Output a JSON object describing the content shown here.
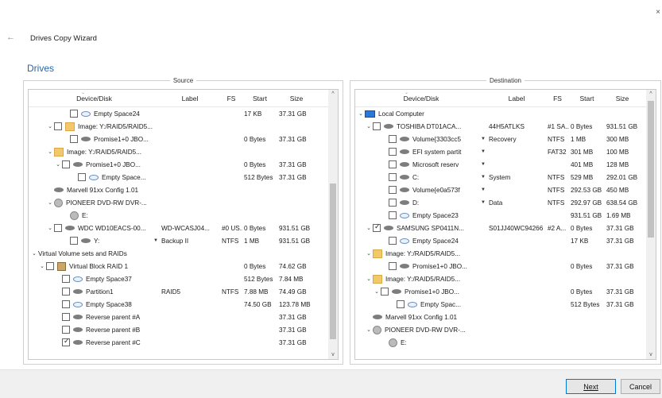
{
  "window": {
    "close_glyph": "×",
    "back_glyph": "←",
    "title": "Drives Copy Wizard"
  },
  "section_title": "Drives",
  "source": {
    "title": "Source",
    "columns": [
      "Device/Disk",
      "Label",
      "FS",
      "Start",
      "Size"
    ],
    "rows": [
      {
        "indent": 4,
        "exp": "",
        "chk": "off",
        "icon": "empty",
        "name": "Empty Space24",
        "label": "",
        "fs": "",
        "start": "17 KB",
        "size": "37.31 GB"
      },
      {
        "indent": 2,
        "exp": "v",
        "chk": "off",
        "icon": "folder",
        "name": "Image: Y:/RAID5/RAID5...",
        "label": "",
        "fs": "",
        "start": "",
        "size": ""
      },
      {
        "indent": 4,
        "exp": "",
        "chk": "off",
        "icon": "hdd",
        "name": "Promise1+0 JBO...",
        "label": "",
        "fs": "",
        "start": "0 Bytes",
        "size": "37.31 GB"
      },
      {
        "indent": 2,
        "exp": "v",
        "chk": "none",
        "icon": "folder",
        "name": "Image: Y:/RAID5/RAID5...",
        "label": "",
        "fs": "",
        "start": "",
        "size": ""
      },
      {
        "indent": 3,
        "exp": "v",
        "chk": "off",
        "icon": "hdd",
        "name": "Promise1+0 JBO...",
        "label": "",
        "fs": "",
        "start": "0 Bytes",
        "size": "37.31 GB"
      },
      {
        "indent": 5,
        "exp": "",
        "chk": "off",
        "icon": "empty",
        "name": "Empty Space...",
        "label": "",
        "fs": "",
        "start": "512 Bytes",
        "size": "37.31 GB"
      },
      {
        "indent": 2,
        "exp": "",
        "chk": "none",
        "icon": "hdd",
        "name": "Marvell 91xx Config 1.01",
        "label": "",
        "fs": "",
        "start": "",
        "size": ""
      },
      {
        "indent": 2,
        "exp": "v",
        "chk": "none",
        "icon": "cd",
        "name": "PIONEER DVD-RW DVR-...",
        "label": "",
        "fs": "",
        "start": "",
        "size": ""
      },
      {
        "indent": 4,
        "exp": "",
        "chk": "none",
        "icon": "cd",
        "name": "E:",
        "label": "",
        "fs": "",
        "start": "",
        "size": ""
      },
      {
        "indent": 2,
        "exp": "v",
        "chk": "off",
        "icon": "hdd",
        "name": "WDC WD10EACS-00...",
        "label": "WD-WCASJ04...",
        "fs": "#0 US...",
        "start": "0 Bytes",
        "size": "931.51 GB"
      },
      {
        "indent": 4,
        "exp": "",
        "chk": "off",
        "icon": "hdd",
        "name": "Y:",
        "dd": "▼",
        "label": "Backup II",
        "fs": "NTFS",
        "start": "1 MB",
        "size": "931.51 GB"
      },
      {
        "indent": 0,
        "exp": "v",
        "chk": "none",
        "icon": "",
        "name": "Virtual Volume sets and RAIDs",
        "label": "",
        "fs": "",
        "start": "",
        "size": ""
      },
      {
        "indent": 1,
        "exp": "v",
        "chk": "off",
        "icon": "raid",
        "name": "Virtual Block RAID 1",
        "label": "",
        "fs": "",
        "start": "0 Bytes",
        "size": "74.62 GB"
      },
      {
        "indent": 3,
        "exp": "",
        "chk": "off",
        "icon": "empty",
        "name": "Empty Space37",
        "label": "",
        "fs": "",
        "start": "512 Bytes",
        "size": "7.84 MB"
      },
      {
        "indent": 3,
        "exp": "",
        "chk": "off",
        "icon": "hdd",
        "name": "Partition1",
        "label": "RAID5",
        "fs": "NTFS",
        "start": "7.88 MB",
        "size": "74.49 GB"
      },
      {
        "indent": 3,
        "exp": "",
        "chk": "off",
        "icon": "empty",
        "name": "Empty Space38",
        "label": "",
        "fs": "",
        "start": "74.50 GB",
        "size": "123.78 MB"
      },
      {
        "indent": 3,
        "exp": "",
        "chk": "off",
        "icon": "hdd",
        "name": "Reverse parent #A",
        "label": "",
        "fs": "",
        "start": "",
        "size": "37.31 GB"
      },
      {
        "indent": 3,
        "exp": "",
        "chk": "off",
        "icon": "hdd",
        "name": "Reverse parent #B",
        "label": "",
        "fs": "",
        "start": "",
        "size": "37.31 GB"
      },
      {
        "indent": 3,
        "exp": "",
        "chk": "on",
        "icon": "hdd",
        "name": "Reverse parent #C",
        "label": "",
        "fs": "",
        "start": "",
        "size": "37.31 GB"
      }
    ]
  },
  "destination": {
    "title": "Destination",
    "columns": [
      "Device/Disk",
      "Label",
      "FS",
      "Start",
      "Size"
    ],
    "rows": [
      {
        "indent": 0,
        "exp": "v",
        "chk": "none",
        "icon": "pc",
        "name": "Local Computer",
        "label": "",
        "fs": "",
        "start": "",
        "size": ""
      },
      {
        "indent": 1,
        "exp": "v",
        "chk": "off",
        "icon": "hdd",
        "name": "TOSHIBA DT01ACA...",
        "label": "44H5ATLKS",
        "fs": "#1 SA...",
        "start": "0 Bytes",
        "size": "931.51 GB"
      },
      {
        "indent": 3,
        "exp": "",
        "chk": "off",
        "icon": "hdd",
        "name": "Volume{3303cc5",
        "dd": "▼",
        "label": "Recovery",
        "fs": "NTFS",
        "start": "1 MB",
        "size": "300 MB"
      },
      {
        "indent": 3,
        "exp": "",
        "chk": "off",
        "icon": "hdd",
        "name": "EFI system partit",
        "dd": "▼",
        "label": "",
        "fs": "FAT32",
        "start": "301 MB",
        "size": "100 MB"
      },
      {
        "indent": 3,
        "exp": "",
        "chk": "off",
        "icon": "hdd",
        "name": "Microsoft reserv",
        "dd": "▼",
        "label": "",
        "fs": "",
        "start": "401 MB",
        "size": "128 MB"
      },
      {
        "indent": 3,
        "exp": "",
        "chk": "off",
        "icon": "hdd",
        "name": "C:",
        "dd": "▼",
        "label": "System",
        "fs": "NTFS",
        "start": "529 MB",
        "size": "292.01 GB"
      },
      {
        "indent": 3,
        "exp": "",
        "chk": "off",
        "icon": "hdd",
        "name": "Volume{e0a573f",
        "dd": "▼",
        "label": "",
        "fs": "NTFS",
        "start": "292.53 GB",
        "size": "450 MB"
      },
      {
        "indent": 3,
        "exp": "",
        "chk": "off",
        "icon": "hdd",
        "name": "D:",
        "dd": "▼",
        "label": "Data",
        "fs": "NTFS",
        "start": "292.97 GB",
        "size": "638.54 GB"
      },
      {
        "indent": 3,
        "exp": "",
        "chk": "off",
        "icon": "empty",
        "name": "Empty Space23",
        "label": "",
        "fs": "",
        "start": "931.51 GB",
        "size": "1.69 MB"
      },
      {
        "indent": 1,
        "exp": "v",
        "chk": "on",
        "icon": "hdd",
        "name": "SAMSUNG SP0411N...",
        "label": "S01JJ40WC94266",
        "fs": "#2 A...",
        "start": "0 Bytes",
        "size": "37.31 GB"
      },
      {
        "indent": 3,
        "exp": "",
        "chk": "off",
        "icon": "empty",
        "name": "Empty Space24",
        "label": "",
        "fs": "",
        "start": "17 KB",
        "size": "37.31 GB"
      },
      {
        "indent": 1,
        "exp": "v",
        "chk": "none",
        "icon": "folder",
        "name": "Image: Y:/RAID5/RAID5...",
        "label": "",
        "fs": "",
        "start": "",
        "size": ""
      },
      {
        "indent": 3,
        "exp": "",
        "chk": "off",
        "icon": "hdd",
        "name": "Promise1+0 JBO...",
        "label": "",
        "fs": "",
        "start": "0 Bytes",
        "size": "37.31 GB"
      },
      {
        "indent": 1,
        "exp": "v",
        "chk": "none",
        "icon": "folder",
        "name": "Image: Y:/RAID5/RAID5...",
        "label": "",
        "fs": "",
        "start": "",
        "size": ""
      },
      {
        "indent": 2,
        "exp": "v",
        "chk": "off",
        "icon": "hdd",
        "name": "Promise1+0 JBO...",
        "label": "",
        "fs": "",
        "start": "0 Bytes",
        "size": "37.31 GB"
      },
      {
        "indent": 4,
        "exp": "",
        "chk": "off",
        "icon": "empty",
        "name": "Empty Spac...",
        "label": "",
        "fs": "",
        "start": "512 Bytes",
        "size": "37.31 GB"
      },
      {
        "indent": 1,
        "exp": "",
        "chk": "none",
        "icon": "hdd",
        "name": "Marvell 91xx Config 1.01",
        "label": "",
        "fs": "",
        "start": "",
        "size": ""
      },
      {
        "indent": 1,
        "exp": "v",
        "chk": "none",
        "icon": "cd",
        "name": "PIONEER DVD-RW DVR-...",
        "label": "",
        "fs": "",
        "start": "",
        "size": ""
      },
      {
        "indent": 3,
        "exp": "",
        "chk": "none",
        "icon": "cd",
        "name": "E:",
        "label": "",
        "fs": "",
        "start": "",
        "size": ""
      }
    ]
  },
  "buttons": {
    "next": "Next",
    "cancel": "Cancel"
  },
  "colors": {
    "accent": "#2a64a8",
    "primary_button_border": "#0078d7"
  },
  "glyphs": {
    "expand": "⌄",
    "scroll_up": "^",
    "scroll_down": "v",
    "header_caret": "⌄"
  }
}
